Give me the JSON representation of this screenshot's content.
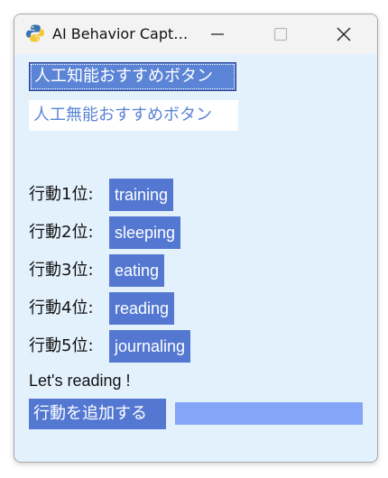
{
  "window": {
    "title": "AI Behavior Capt…",
    "minimize_icon": "minimize-icon",
    "maximize_icon": "maximize-icon",
    "close_icon": "close-icon",
    "app_icon": "python-icon"
  },
  "buttons": {
    "ai_recommend": "人工知能おすすめボタン",
    "muno_recommend": "人工無能おすすめボタン",
    "add_action": "行動を追加する"
  },
  "ranking": [
    {
      "label": "行動1位:",
      "value": "training"
    },
    {
      "label": "行動2位:",
      "value": "sleeping"
    },
    {
      "label": "行動3位:",
      "value": "eating"
    },
    {
      "label": "行動4位:",
      "value": "reading"
    },
    {
      "label": "行動5位:",
      "value": "journaling"
    }
  ],
  "message": "Let's reading !",
  "add_input": {
    "value": "",
    "placeholder": ""
  },
  "colors": {
    "client_bg": "#e3f1fd",
    "accent": "#5478d1",
    "input_bg": "#85a6f8"
  }
}
